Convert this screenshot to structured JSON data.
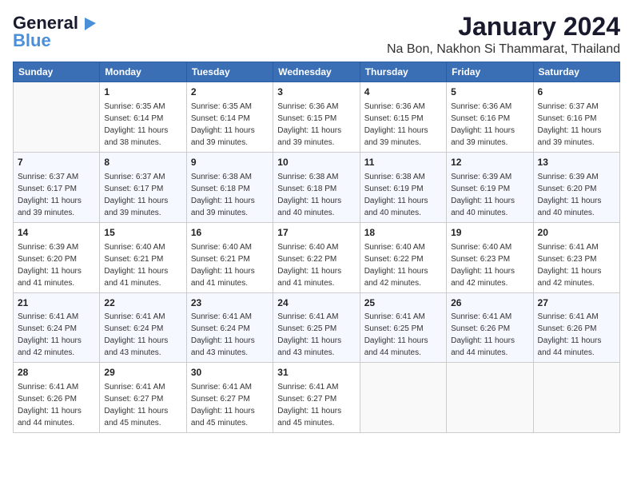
{
  "logo": {
    "line1": "General",
    "line2": "Blue"
  },
  "title": "January 2024",
  "subtitle": "Na Bon, Nakhon Si Thammarat, Thailand",
  "days_of_week": [
    "Sunday",
    "Monday",
    "Tuesday",
    "Wednesday",
    "Thursday",
    "Friday",
    "Saturday"
  ],
  "weeks": [
    [
      {
        "day": "",
        "sunrise": "",
        "sunset": "",
        "daylight": ""
      },
      {
        "day": "1",
        "sunrise": "Sunrise: 6:35 AM",
        "sunset": "Sunset: 6:14 PM",
        "daylight": "Daylight: 11 hours and 38 minutes."
      },
      {
        "day": "2",
        "sunrise": "Sunrise: 6:35 AM",
        "sunset": "Sunset: 6:14 PM",
        "daylight": "Daylight: 11 hours and 39 minutes."
      },
      {
        "day": "3",
        "sunrise": "Sunrise: 6:36 AM",
        "sunset": "Sunset: 6:15 PM",
        "daylight": "Daylight: 11 hours and 39 minutes."
      },
      {
        "day": "4",
        "sunrise": "Sunrise: 6:36 AM",
        "sunset": "Sunset: 6:15 PM",
        "daylight": "Daylight: 11 hours and 39 minutes."
      },
      {
        "day": "5",
        "sunrise": "Sunrise: 6:36 AM",
        "sunset": "Sunset: 6:16 PM",
        "daylight": "Daylight: 11 hours and 39 minutes."
      },
      {
        "day": "6",
        "sunrise": "Sunrise: 6:37 AM",
        "sunset": "Sunset: 6:16 PM",
        "daylight": "Daylight: 11 hours and 39 minutes."
      }
    ],
    [
      {
        "day": "7",
        "sunrise": "Sunrise: 6:37 AM",
        "sunset": "Sunset: 6:17 PM",
        "daylight": "Daylight: 11 hours and 39 minutes."
      },
      {
        "day": "8",
        "sunrise": "Sunrise: 6:37 AM",
        "sunset": "Sunset: 6:17 PM",
        "daylight": "Daylight: 11 hours and 39 minutes."
      },
      {
        "day": "9",
        "sunrise": "Sunrise: 6:38 AM",
        "sunset": "Sunset: 6:18 PM",
        "daylight": "Daylight: 11 hours and 39 minutes."
      },
      {
        "day": "10",
        "sunrise": "Sunrise: 6:38 AM",
        "sunset": "Sunset: 6:18 PM",
        "daylight": "Daylight: 11 hours and 40 minutes."
      },
      {
        "day": "11",
        "sunrise": "Sunrise: 6:38 AM",
        "sunset": "Sunset: 6:19 PM",
        "daylight": "Daylight: 11 hours and 40 minutes."
      },
      {
        "day": "12",
        "sunrise": "Sunrise: 6:39 AM",
        "sunset": "Sunset: 6:19 PM",
        "daylight": "Daylight: 11 hours and 40 minutes."
      },
      {
        "day": "13",
        "sunrise": "Sunrise: 6:39 AM",
        "sunset": "Sunset: 6:20 PM",
        "daylight": "Daylight: 11 hours and 40 minutes."
      }
    ],
    [
      {
        "day": "14",
        "sunrise": "Sunrise: 6:39 AM",
        "sunset": "Sunset: 6:20 PM",
        "daylight": "Daylight: 11 hours and 41 minutes."
      },
      {
        "day": "15",
        "sunrise": "Sunrise: 6:40 AM",
        "sunset": "Sunset: 6:21 PM",
        "daylight": "Daylight: 11 hours and 41 minutes."
      },
      {
        "day": "16",
        "sunrise": "Sunrise: 6:40 AM",
        "sunset": "Sunset: 6:21 PM",
        "daylight": "Daylight: 11 hours and 41 minutes."
      },
      {
        "day": "17",
        "sunrise": "Sunrise: 6:40 AM",
        "sunset": "Sunset: 6:22 PM",
        "daylight": "Daylight: 11 hours and 41 minutes."
      },
      {
        "day": "18",
        "sunrise": "Sunrise: 6:40 AM",
        "sunset": "Sunset: 6:22 PM",
        "daylight": "Daylight: 11 hours and 42 minutes."
      },
      {
        "day": "19",
        "sunrise": "Sunrise: 6:40 AM",
        "sunset": "Sunset: 6:23 PM",
        "daylight": "Daylight: 11 hours and 42 minutes."
      },
      {
        "day": "20",
        "sunrise": "Sunrise: 6:41 AM",
        "sunset": "Sunset: 6:23 PM",
        "daylight": "Daylight: 11 hours and 42 minutes."
      }
    ],
    [
      {
        "day": "21",
        "sunrise": "Sunrise: 6:41 AM",
        "sunset": "Sunset: 6:24 PM",
        "daylight": "Daylight: 11 hours and 42 minutes."
      },
      {
        "day": "22",
        "sunrise": "Sunrise: 6:41 AM",
        "sunset": "Sunset: 6:24 PM",
        "daylight": "Daylight: 11 hours and 43 minutes."
      },
      {
        "day": "23",
        "sunrise": "Sunrise: 6:41 AM",
        "sunset": "Sunset: 6:24 PM",
        "daylight": "Daylight: 11 hours and 43 minutes."
      },
      {
        "day": "24",
        "sunrise": "Sunrise: 6:41 AM",
        "sunset": "Sunset: 6:25 PM",
        "daylight": "Daylight: 11 hours and 43 minutes."
      },
      {
        "day": "25",
        "sunrise": "Sunrise: 6:41 AM",
        "sunset": "Sunset: 6:25 PM",
        "daylight": "Daylight: 11 hours and 44 minutes."
      },
      {
        "day": "26",
        "sunrise": "Sunrise: 6:41 AM",
        "sunset": "Sunset: 6:26 PM",
        "daylight": "Daylight: 11 hours and 44 minutes."
      },
      {
        "day": "27",
        "sunrise": "Sunrise: 6:41 AM",
        "sunset": "Sunset: 6:26 PM",
        "daylight": "Daylight: 11 hours and 44 minutes."
      }
    ],
    [
      {
        "day": "28",
        "sunrise": "Sunrise: 6:41 AM",
        "sunset": "Sunset: 6:26 PM",
        "daylight": "Daylight: 11 hours and 44 minutes."
      },
      {
        "day": "29",
        "sunrise": "Sunrise: 6:41 AM",
        "sunset": "Sunset: 6:27 PM",
        "daylight": "Daylight: 11 hours and 45 minutes."
      },
      {
        "day": "30",
        "sunrise": "Sunrise: 6:41 AM",
        "sunset": "Sunset: 6:27 PM",
        "daylight": "Daylight: 11 hours and 45 minutes."
      },
      {
        "day": "31",
        "sunrise": "Sunrise: 6:41 AM",
        "sunset": "Sunset: 6:27 PM",
        "daylight": "Daylight: 11 hours and 45 minutes."
      },
      {
        "day": "",
        "sunrise": "",
        "sunset": "",
        "daylight": ""
      },
      {
        "day": "",
        "sunrise": "",
        "sunset": "",
        "daylight": ""
      },
      {
        "day": "",
        "sunrise": "",
        "sunset": "",
        "daylight": ""
      }
    ]
  ]
}
